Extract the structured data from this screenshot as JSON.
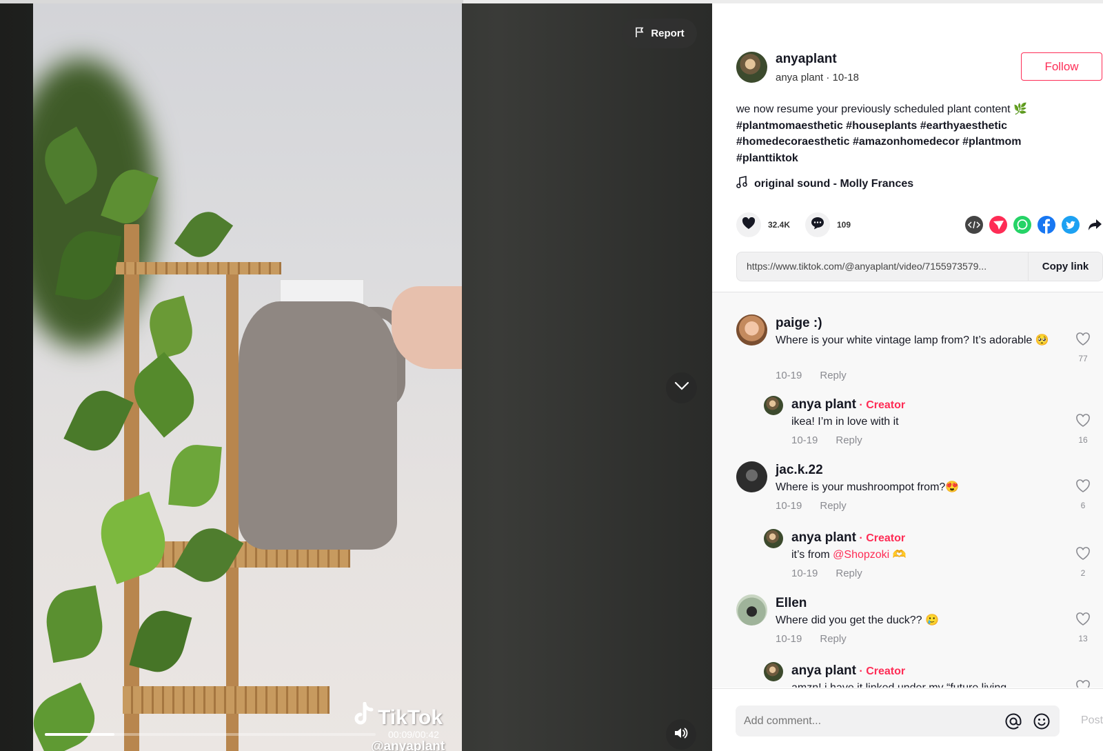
{
  "video": {
    "report_label": "Report",
    "time_readout": "00:09/00:42",
    "progress": 0.21,
    "watermark_brand": "TikTok",
    "watermark_handle": "@anyaplant"
  },
  "post": {
    "author_username": "anyaplant",
    "author_nickname": "anya plant",
    "post_date": "10-18",
    "follow_label": "Follow",
    "caption_text": "we now resume your previously scheduled plant content 🌿",
    "hashtags": [
      "#plantmomaesthetic",
      "#houseplants",
      "#earthyaesthetic",
      "#homedecoraesthetic",
      "#amazonhomedecor",
      "#plantmom",
      "#planttiktok"
    ],
    "music": "original sound - Molly Frances",
    "likes": "32.4K",
    "comments_count": "109",
    "share_link": "https://www.tiktok.com/@anyaplant/video/7155973579...",
    "copy_link_label": "Copy link"
  },
  "share_icons": [
    {
      "name": "embed-icon",
      "color": "#444444"
    },
    {
      "name": "send-to-friends-icon",
      "color": "#fe2c55"
    },
    {
      "name": "whatsapp-icon",
      "color": "#25d366"
    },
    {
      "name": "facebook-icon",
      "color": "#1877f2"
    },
    {
      "name": "twitter-icon",
      "color": "#1da1f2"
    },
    {
      "name": "share-arrow-icon",
      "color": "#161823"
    }
  ],
  "comments": [
    {
      "user": "paige :)",
      "text": "Where is your white vintage lamp from? It’s adorable 🥺",
      "date": "10-19",
      "reply": "Reply",
      "likes": "77"
    },
    {
      "user": "anya plant",
      "creator": "Creator",
      "text": "ikea! I’m in love with it",
      "date": "10-19",
      "reply": "Reply",
      "likes": "16"
    },
    {
      "user": "jac.k.22",
      "text": "Where is your mushroompot from?😍",
      "date": "10-19",
      "reply": "Reply",
      "likes": "6"
    },
    {
      "user": "anya plant",
      "creator": "Creator",
      "text_prefix": "it’s from ",
      "mention": "@Shopzoki",
      "text_suffix": " 🫶",
      "date": "10-19",
      "reply": "Reply",
      "likes": "2"
    },
    {
      "user": "Ellen",
      "text": "Where did you get the duck?? 🥲",
      "date": "10-19",
      "reply": "Reply",
      "likes": "13"
    },
    {
      "user": "anya plant",
      "creator": "Creator",
      "text": "amzn! i have it linked under my “future living"
    }
  ],
  "comment_bar": {
    "placeholder": "Add comment...",
    "post_label": "Post"
  },
  "colors": {
    "accent": "#fe2c55",
    "text": "#161823",
    "muted": "#8a8b91"
  }
}
